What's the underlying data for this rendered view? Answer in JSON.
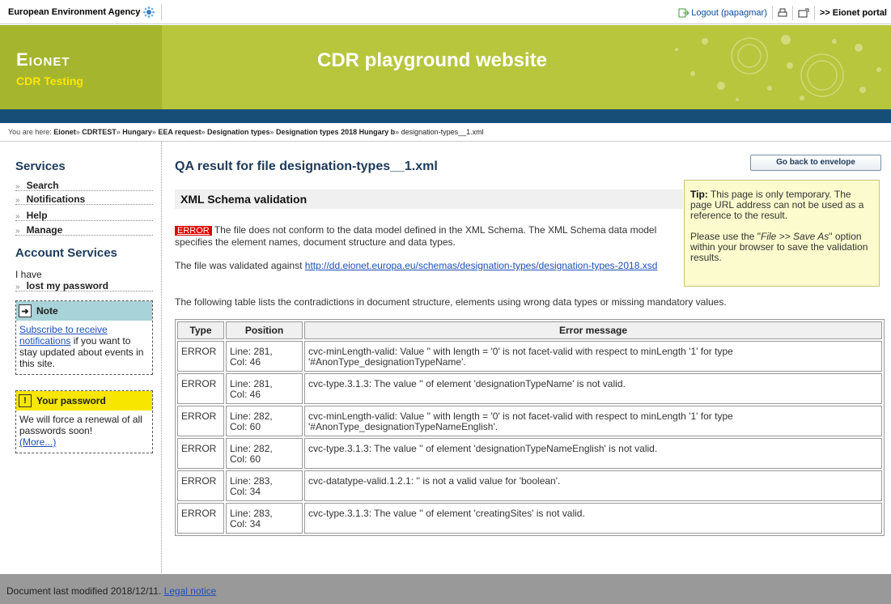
{
  "toolbar": {
    "agency": "European Environment Agency",
    "logout": "Logout (papagmar)",
    "portal": ">> Eionet portal"
  },
  "banner": {
    "brand": "Eionet",
    "subtitle": "CDR Testing",
    "site_title": "CDR playground website"
  },
  "breadcrumb": {
    "prefix": "You are here:",
    "items": [
      "Eionet",
      "CDRTEST",
      "Hungary",
      "EEA request",
      "Designation types",
      "Designation types 2018 Hungary b"
    ],
    "current": "designation-types__1.xml"
  },
  "sidebar": {
    "services_title": "Services",
    "services": [
      "Search",
      "Notifications",
      "Help",
      "Manage"
    ],
    "account_title": "Account Services",
    "ihave": "I have",
    "lost_password": "lost my password",
    "note": {
      "title": "Note",
      "link": "Subscribe to receive notifications",
      "text": " if you want to stay updated about events in this site."
    },
    "password": {
      "title": "Your password",
      "text": "We will force a renewal of all passwords soon!",
      "more": "(More...)"
    }
  },
  "main": {
    "title": "QA result for file designation-types__1.xml",
    "back_button": "Go back to envelope",
    "section_title": "XML Schema validation",
    "error_badge": "ERROR",
    "error_text": "The file does not conform to the data model defined in the XML Schema. The XML Schema data model specifies the element names, document structure and data types.",
    "validated_prefix": "The file was validated against ",
    "schema_url": "http://dd.eionet.europa.eu/schemas/designation-types/designation-types-2018.xsd",
    "table_intro": "The following table lists the contradictions in document structure, elements using wrong data types or missing mandatory values.",
    "tip": {
      "label": "Tip:",
      "text1": " This page is only temporary. The page URL address can not be used as a reference to the result.",
      "text2a": "Please use the \"",
      "text2em": "File >> Save As",
      "text2b": "\" option within your browser to save the validation results."
    },
    "table": {
      "headers": [
        "Type",
        "Position",
        "Error message"
      ],
      "rows": [
        {
          "type": "ERROR",
          "line": "Line: 281,",
          "col": "Col: 46",
          "message": "cvc-minLength-valid: Value '' with length = '0' is not facet-valid with respect to minLength '1' for type '#AnonType_designationTypeName'."
        },
        {
          "type": "ERROR",
          "line": "Line: 281,",
          "col": "Col: 46",
          "message": "cvc-type.3.1.3: The value '' of element 'designationTypeName' is not valid."
        },
        {
          "type": "ERROR",
          "line": "Line: 282,",
          "col": "Col: 60",
          "message": "cvc-minLength-valid: Value '' with length = '0' is not facet-valid with respect to minLength '1' for type '#AnonType_designationTypeNameEnglish'."
        },
        {
          "type": "ERROR",
          "line": "Line: 282,",
          "col": "Col: 60",
          "message": "cvc-type.3.1.3: The value '' of element 'designationTypeNameEnglish' is not valid."
        },
        {
          "type": "ERROR",
          "line": "Line: 283,",
          "col": "Col: 34",
          "message": "cvc-datatype-valid.1.2.1: '' is not a valid value for 'boolean'."
        },
        {
          "type": "ERROR",
          "line": "Line: 283,",
          "col": "Col: 34",
          "message": "cvc-type.3.1.3: The value '' of element 'creatingSites' is not valid."
        }
      ]
    }
  },
  "footer": {
    "text": "Document last modified 2018/12/11. ",
    "legal": "Legal notice"
  },
  "colors": {
    "banner": "#b7c63d",
    "blue_bar": "#164e78",
    "error_red": "#dd0000",
    "tip_bg": "#fcfbcd"
  }
}
